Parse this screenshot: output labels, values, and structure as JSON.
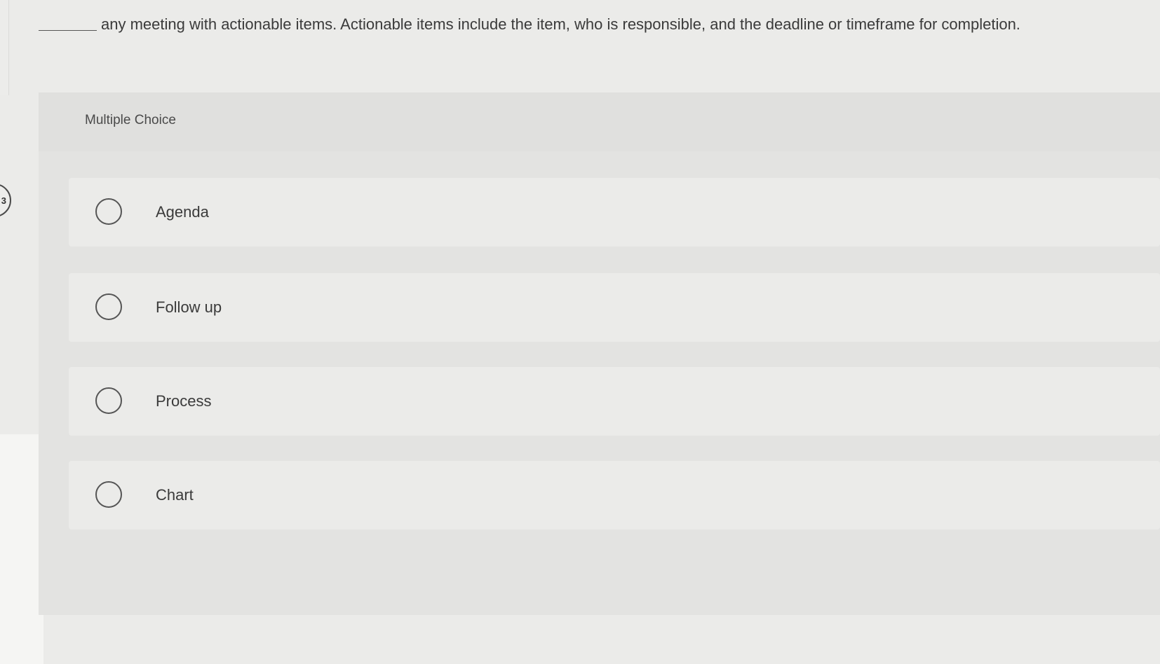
{
  "question": {
    "text": "any meeting with actionable items. Actionable items include the item, who is responsible, and the deadline or timeframe for completion."
  },
  "nav_tab_label": "3",
  "multiple_choice": {
    "label": "Multiple Choice",
    "options": [
      {
        "label": "Agenda",
        "selected": false
      },
      {
        "label": "Follow up",
        "selected": false
      },
      {
        "label": "Process",
        "selected": false
      },
      {
        "label": "Chart",
        "selected": false
      }
    ]
  }
}
